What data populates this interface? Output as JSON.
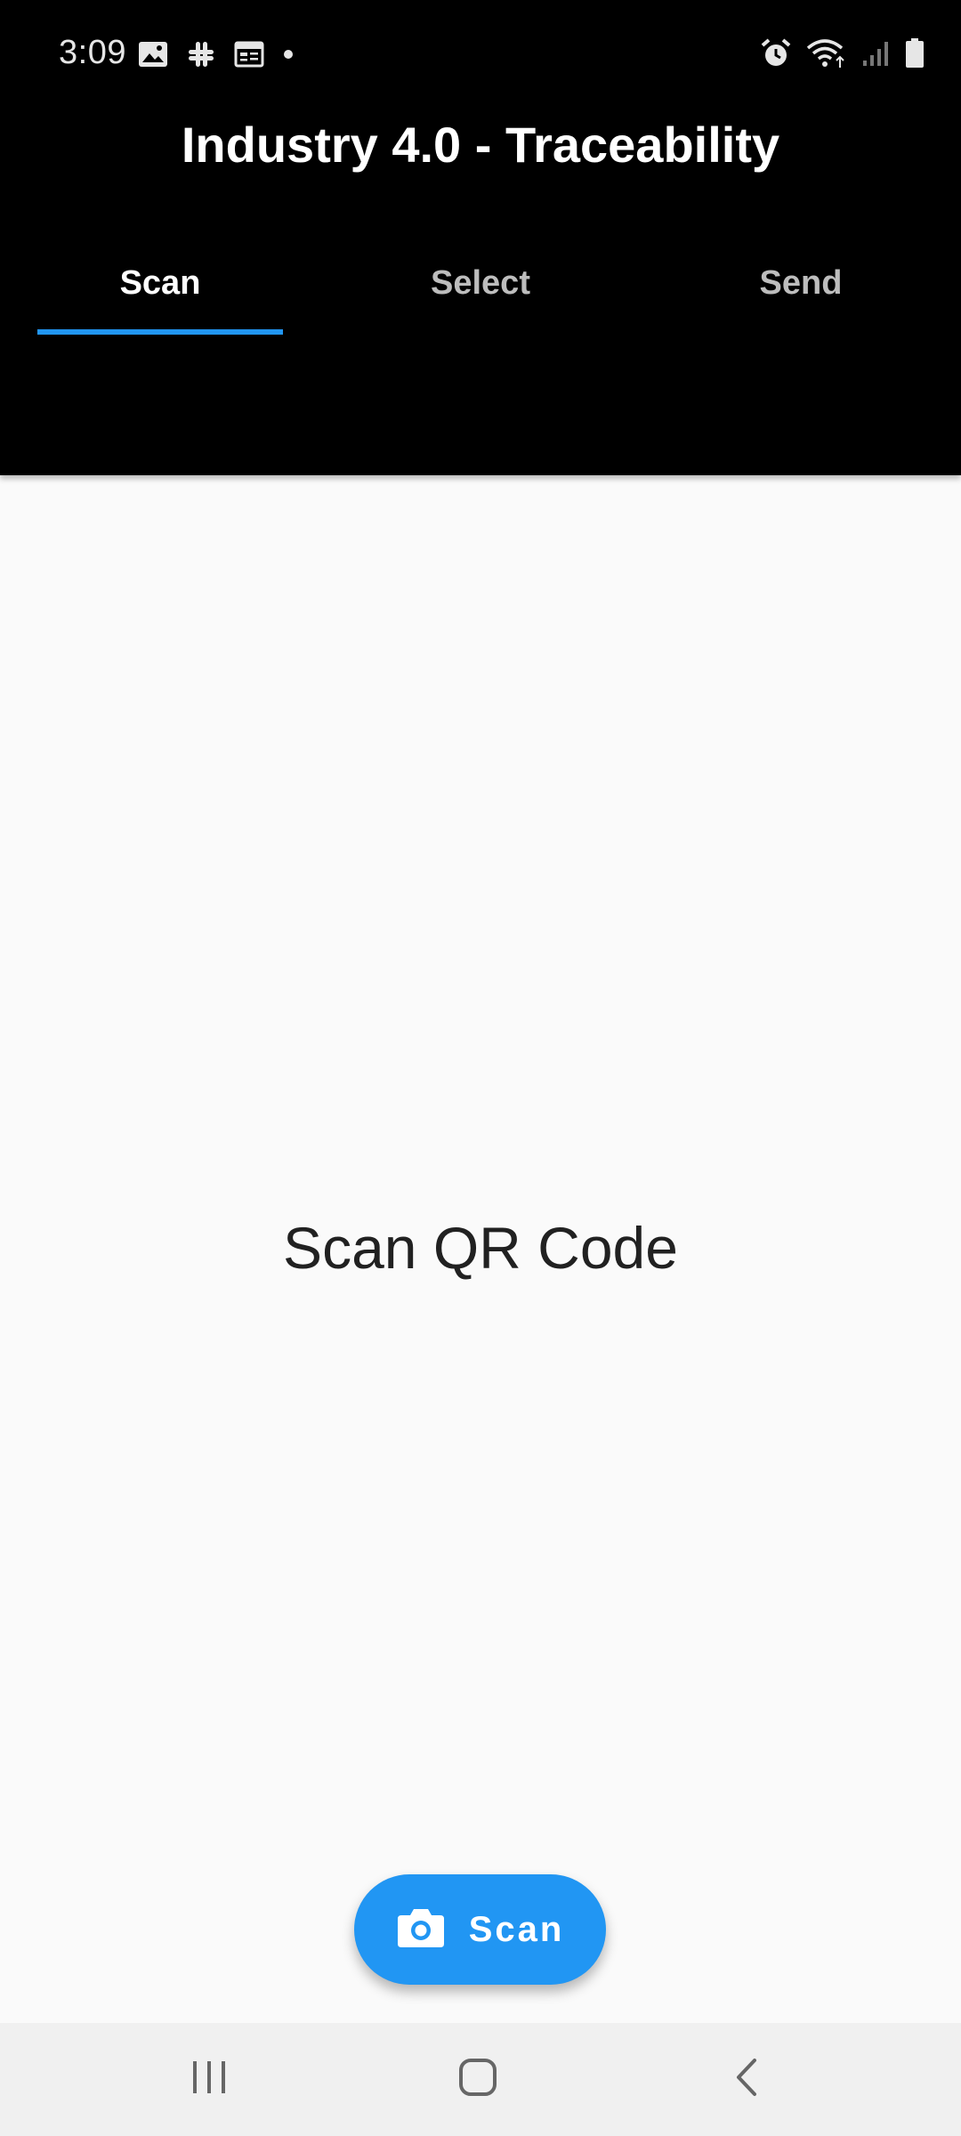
{
  "status_bar": {
    "time": "3:09",
    "left_icons": [
      "image-icon",
      "slack-icon",
      "calendar-icon",
      "dot-icon"
    ],
    "right_icons": [
      "alarm-icon",
      "wifi-icon",
      "signal-icon",
      "battery-icon"
    ]
  },
  "app_bar": {
    "title": "Industry 4.0 - Traceability",
    "tabs": [
      {
        "label": "Scan",
        "active": true
      },
      {
        "label": "Select",
        "active": false
      },
      {
        "label": "Send",
        "active": false
      }
    ],
    "indicator_color": "#2196f3"
  },
  "main": {
    "message": "Scan QR Code"
  },
  "fab": {
    "icon": "camera-icon",
    "label": "Scan",
    "color": "#2196f3"
  },
  "nav_bar": {
    "buttons": [
      "recent-apps-icon",
      "home-icon",
      "back-icon"
    ]
  }
}
